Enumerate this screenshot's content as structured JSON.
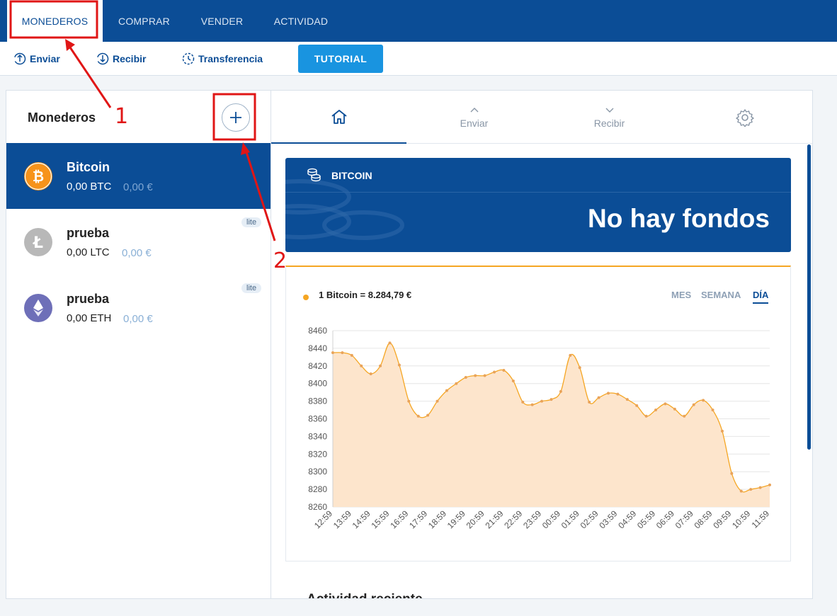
{
  "topnav": {
    "tabs": [
      {
        "label": "MONEDEROS",
        "active": true
      },
      {
        "label": "COMPRAR",
        "active": false
      },
      {
        "label": "VENDER",
        "active": false
      },
      {
        "label": "ACTIVIDAD",
        "active": false
      }
    ]
  },
  "actions": {
    "send": "Enviar",
    "receive": "Recibir",
    "transfer": "Transferencia",
    "tutorial": "TUTORIAL"
  },
  "wallets_panel": {
    "title": "Monederos",
    "add_icon": "plus-icon",
    "wallets": [
      {
        "name": "Bitcoin",
        "balance": "0,00 BTC",
        "fiat": "0,00 €",
        "coin": "bitcoin-icon",
        "color": "#f7931a",
        "lite": "",
        "active": true
      },
      {
        "name": "prueba",
        "balance": "0,00 LTC",
        "fiat": "0,00 €",
        "coin": "litecoin-icon",
        "color": "#b8b8b8",
        "lite": "lite",
        "active": false
      },
      {
        "name": "prueba",
        "balance": "0,00 ETH",
        "fiat": "0,00 €",
        "coin": "ethereum-icon",
        "color": "#6e6fb8",
        "lite": "lite",
        "active": false
      }
    ]
  },
  "detail_tabs": {
    "home_icon": "home-icon",
    "send": "Enviar",
    "receive": "Recibir",
    "settings_icon": "gear-icon"
  },
  "banner": {
    "label": "BITCOIN",
    "message": "No hay fondos"
  },
  "chart_card": {
    "price_label": "1 Bitcoin = 8.284,79 €",
    "ranges": [
      "MES",
      "SEMANA",
      "DÍA"
    ],
    "active_range": "DÍA"
  },
  "recent_title": "Actividad reciente",
  "annotations": {
    "one": "1",
    "two": "2"
  },
  "colors": {
    "brand": "#0b4d96",
    "accent": "#1994e0",
    "line": "#f5a623",
    "fill": "#fde5cc",
    "annotation": "#e01616"
  },
  "chart_data": {
    "type": "area",
    "title": "",
    "xlabel": "",
    "ylabel": "",
    "x": [
      "12:59",
      "13:59",
      "14:59",
      "15:59",
      "16:59",
      "17:59",
      "18:59",
      "19:59",
      "20:59",
      "21:59",
      "22:59",
      "23:59",
      "00:59",
      "01:59",
      "02:59",
      "03:59",
      "04:59",
      "05:59",
      "06:59",
      "07:59",
      "08:59",
      "09:59",
      "10:59",
      "11:59"
    ],
    "ylim": [
      8260,
      8460
    ],
    "yticks": [
      8260,
      8280,
      8300,
      8320,
      8340,
      8360,
      8380,
      8400,
      8420,
      8440,
      8460
    ],
    "grid": true,
    "series": [
      {
        "values_x": [
          0,
          0.5,
          1,
          1.5,
          2,
          2.5,
          3,
          3.5,
          4,
          4.5,
          5,
          5.5,
          6,
          6.5,
          7,
          7.5,
          8,
          8.5,
          9,
          9.5,
          10,
          10.5,
          11,
          11.5,
          12,
          12.5,
          13,
          13.5,
          14,
          14.5,
          15,
          15.5,
          16,
          16.5,
          17,
          17.5,
          18,
          18.5,
          19,
          19.5,
          20,
          20.5,
          21,
          21.5,
          22,
          22.5,
          23
        ],
        "values": [
          8435,
          8435,
          8432,
          8420,
          8411,
          8420,
          8446,
          8421,
          8380,
          8363,
          8364,
          8380,
          8392,
          8400,
          8407,
          8409,
          8409,
          8413,
          8415,
          8403,
          8379,
          8376,
          8380,
          8382,
          8391,
          8432,
          8418,
          8379,
          8384,
          8389,
          8388,
          8382,
          8375,
          8363,
          8370,
          8377,
          8371,
          8363,
          8376,
          8381,
          8370,
          8346,
          8298,
          8278,
          8280,
          8282,
          8285
        ]
      }
    ]
  }
}
